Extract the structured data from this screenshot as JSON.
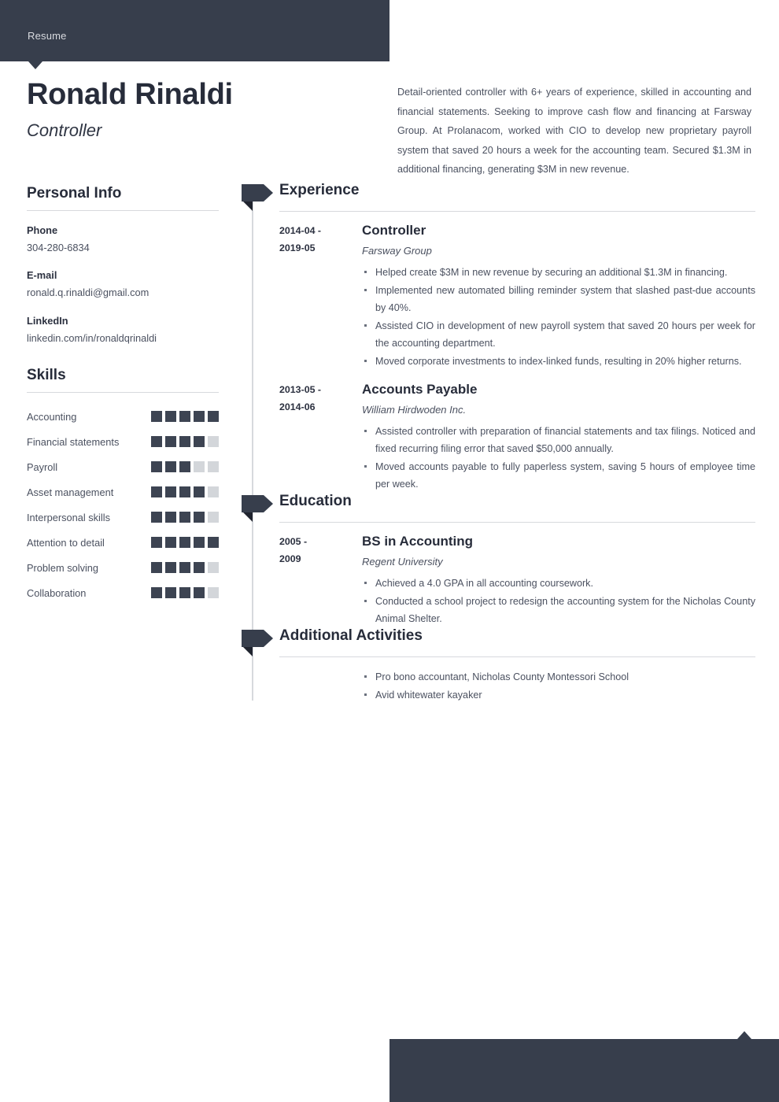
{
  "document_label": "Resume",
  "colors": {
    "accent_dark": "#373e4c",
    "text_dark": "#272c3a",
    "text_body": "#4b5160",
    "rule": "#d7d9dd",
    "skill_on": "#3d4452",
    "skill_off": "#d3d6da"
  },
  "header": {
    "name": "Ronald Rinaldi",
    "title": "Controller",
    "summary": "Detail-oriented controller with 6+ years of experience, skilled in accounting and financial statements. Seeking to improve cash flow and financing at Farsway Group. At Prolanacom, worked with CIO to develop new proprietary payroll system that saved 20 hours a week for the accounting team. Secured $1.3M in additional financing, generating $3M in new revenue."
  },
  "personal_info": {
    "heading": "Personal Info",
    "fields": [
      {
        "label": "Phone",
        "value": "304-280-6834"
      },
      {
        "label": "E-mail",
        "value": "ronald.q.rinaldi@gmail.com"
      },
      {
        "label": "LinkedIn",
        "value": "linkedin.com/in/ronaldqrinaldi"
      }
    ]
  },
  "skills": {
    "heading": "Skills",
    "max_level": 5,
    "items": [
      {
        "name": "Accounting",
        "level": 5
      },
      {
        "name": "Financial statements",
        "level": 4
      },
      {
        "name": "Payroll",
        "level": 3
      },
      {
        "name": "Asset management",
        "level": 4
      },
      {
        "name": "Interpersonal skills",
        "level": 4
      },
      {
        "name": "Attention to detail",
        "level": 5
      },
      {
        "name": "Problem solving",
        "level": 4
      },
      {
        "name": "Collaboration",
        "level": 4
      }
    ]
  },
  "experience": {
    "heading": "Experience",
    "entries": [
      {
        "dates": "2014-04 - 2019-05",
        "date_from": "2014-04 -",
        "date_to": "2019-05",
        "role": "Controller",
        "org": "Farsway Group",
        "bullets": [
          "Helped create $3M in new revenue by securing an additional $1.3M in financing.",
          "Implemented new automated billing reminder system that slashed past-due accounts by 40%.",
          "Assisted CIO in development of new payroll system that saved 20 hours per week for the accounting department.",
          "Moved corporate investments to index-linked funds, resulting in 20% higher returns."
        ]
      },
      {
        "dates": "2013-05 - 2014-06",
        "date_from": "2013-05 -",
        "date_to": "2014-06",
        "role": "Accounts Payable",
        "org": "William Hirdwoden Inc.",
        "bullets": [
          "Assisted controller with preparation of financial statements and tax filings. Noticed and fixed recurring filing error that saved $50,000 annually.",
          "Moved accounts payable to fully paperless system, saving 5 hours of employee time per week."
        ]
      }
    ]
  },
  "education": {
    "heading": "Education",
    "entries": [
      {
        "dates": "2005 - 2009",
        "date_from": "2005 -",
        "date_to": "2009",
        "role": "BS in Accounting",
        "org": "Regent University",
        "bullets": [
          "Achieved a 4.0 GPA in all accounting coursework.",
          "Conducted a school project to redesign the accounting system for the Nicholas County Animal Shelter."
        ]
      }
    ]
  },
  "additional_activities": {
    "heading": "Additional Activities",
    "entries": [
      {
        "date_from": "",
        "date_to": "",
        "role": "",
        "org": "",
        "bullets": [
          "Pro bono accountant, Nicholas County Montessori School",
          "Avid whitewater kayaker"
        ]
      }
    ]
  }
}
